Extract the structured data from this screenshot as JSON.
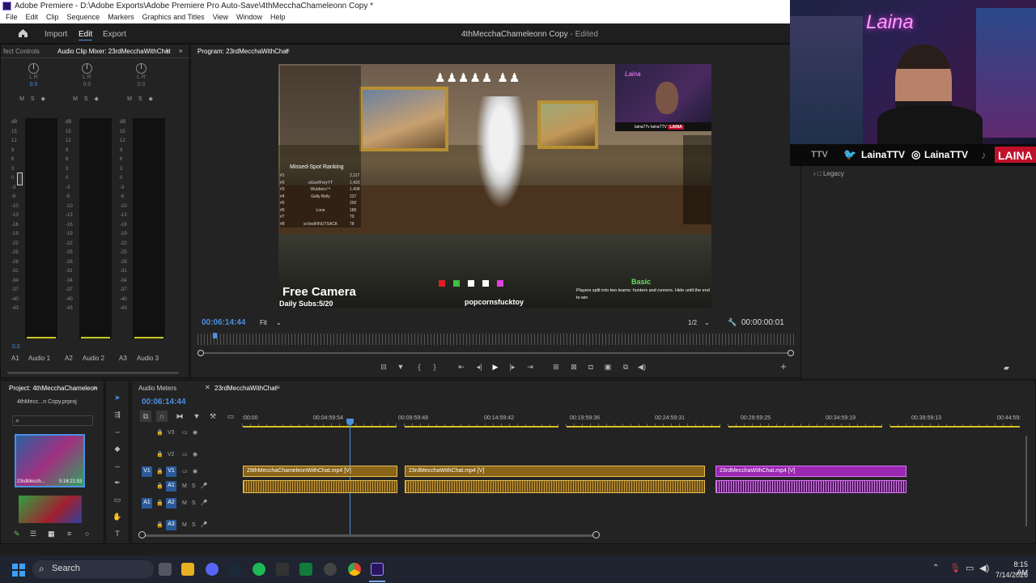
{
  "window": {
    "title": "Adobe Premiere - D:\\Adobe Exports\\Adobe Premiere Pro Auto-Save\\4thMecchaChameleonn Copy *"
  },
  "menu": [
    "File",
    "Edit",
    "Clip",
    "Sequence",
    "Markers",
    "Graphics and Titles",
    "View",
    "Window",
    "Help"
  ],
  "workspace": {
    "tabs": [
      "Import",
      "Edit",
      "Export"
    ],
    "active": "Edit",
    "doc_title": "4thMecchaChameleonn Copy",
    "doc_status": "- Edited"
  },
  "mixer": {
    "tab_effects": "fect Controls",
    "tab_title": "Audio Clip Mixer: 23rdMecchaWithChat",
    "tracks": [
      {
        "id": "A1",
        "name": "Audio 1",
        "lr": "L    R",
        "val": "0.0"
      },
      {
        "id": "A2",
        "name": "Audio 2",
        "lr": "L    R",
        "val": "0.0"
      },
      {
        "id": "A3",
        "name": "Audio 3",
        "lr": "L    R",
        "val": "0.0"
      }
    ],
    "msr": "M S ◆",
    "scale": [
      "dB",
      "15",
      "12",
      "9",
      "6",
      "3",
      "0",
      "-3",
      "-6",
      "-10",
      "-13",
      "-16",
      "-19",
      "-22",
      "-25",
      "-28",
      "-31",
      "-34",
      "-37",
      "-40",
      "-43"
    ],
    "master_val": "0.0"
  },
  "program": {
    "tab": "Program: 23rdMecchaWithChat",
    "timecode": "00:06:14:44",
    "fit": "Fit",
    "resolution": "1/2",
    "duration": "00:00:00:01"
  },
  "video": {
    "overlay_title": "Free Camera",
    "daily_subs": "Daily Subs:5/20",
    "username": "popcornsfucktoy",
    "mode": "Basic",
    "info": "Players split into two teams: hunters and runners. Hide until the end to win",
    "ranking_title": "Missed-Spot Ranking",
    "ranking": [
      {
        "rank": "#1",
        "name": "",
        "score": "2,117"
      },
      {
        "rank": "#2",
        "name": "oGoofFreyYT",
        "score": "1,420"
      },
      {
        "rank": "#3",
        "name": "Wubbers™",
        "score": "1,408"
      },
      {
        "rank": "#4",
        "name": "Gelly Belly",
        "score": "227"
      },
      {
        "rank": "#5",
        "name": "",
        "score": "200"
      },
      {
        "rank": "#6",
        "name": "Lone",
        "score": "180"
      },
      {
        "rank": "#7",
        "name": "",
        "score": "79"
      },
      {
        "rank": "#8",
        "name": "xx'dxdFtNUTSACK",
        "score": "78"
      }
    ],
    "cam_name": "Laina",
    "cam_social": "laina77v   lainaTTV",
    "cam_brand": "LAINA"
  },
  "webcam": {
    "neon": "Laina",
    "social1": "LainaTTV",
    "social2": "LainaTTV",
    "brand": "LAINA",
    "prefix": "TTV"
  },
  "legacy": {
    "label": "Legacy"
  },
  "project": {
    "tab": "Project: 4thMecchaChameleon",
    "file": "4thMecc...n Copy.prproj",
    "thumb_label": "23rdMecch...",
    "thumb_dur": "5:16:21:53"
  },
  "timeline": {
    "tab_meters": "Audio Meters",
    "tab_seq": "23rdMecchaWithChat",
    "timecode": "00:06:14:44",
    "ruler": [
      ":00:00",
      "00:04:59:54",
      "00:09:59:48",
      "00:14:59:42",
      "00:19:59:36",
      "00:24:59:31",
      "00:29:59:25",
      "00:34:59:19",
      "00:39:59:13",
      "00:44:59:"
    ],
    "tracks": {
      "v3": "V3",
      "v2": "V2",
      "v1": "V1",
      "a1": "A1",
      "a2": "A2",
      "a3": "A3",
      "src_v1": "V1",
      "src_a1": "A1"
    },
    "clips": [
      {
        "label": "29thMecchaChameleonWithChat.mp4 [V]",
        "color": "orange"
      },
      {
        "label": "23rdMecchaWithChat.mp4 [V]",
        "color": "orange"
      },
      {
        "label": "23rdMecchaWithChat.mp4 [V]",
        "color": "purple"
      }
    ]
  },
  "taskbar": {
    "search": "Search",
    "time": "8:15 AM",
    "date": "7/14/2026"
  }
}
